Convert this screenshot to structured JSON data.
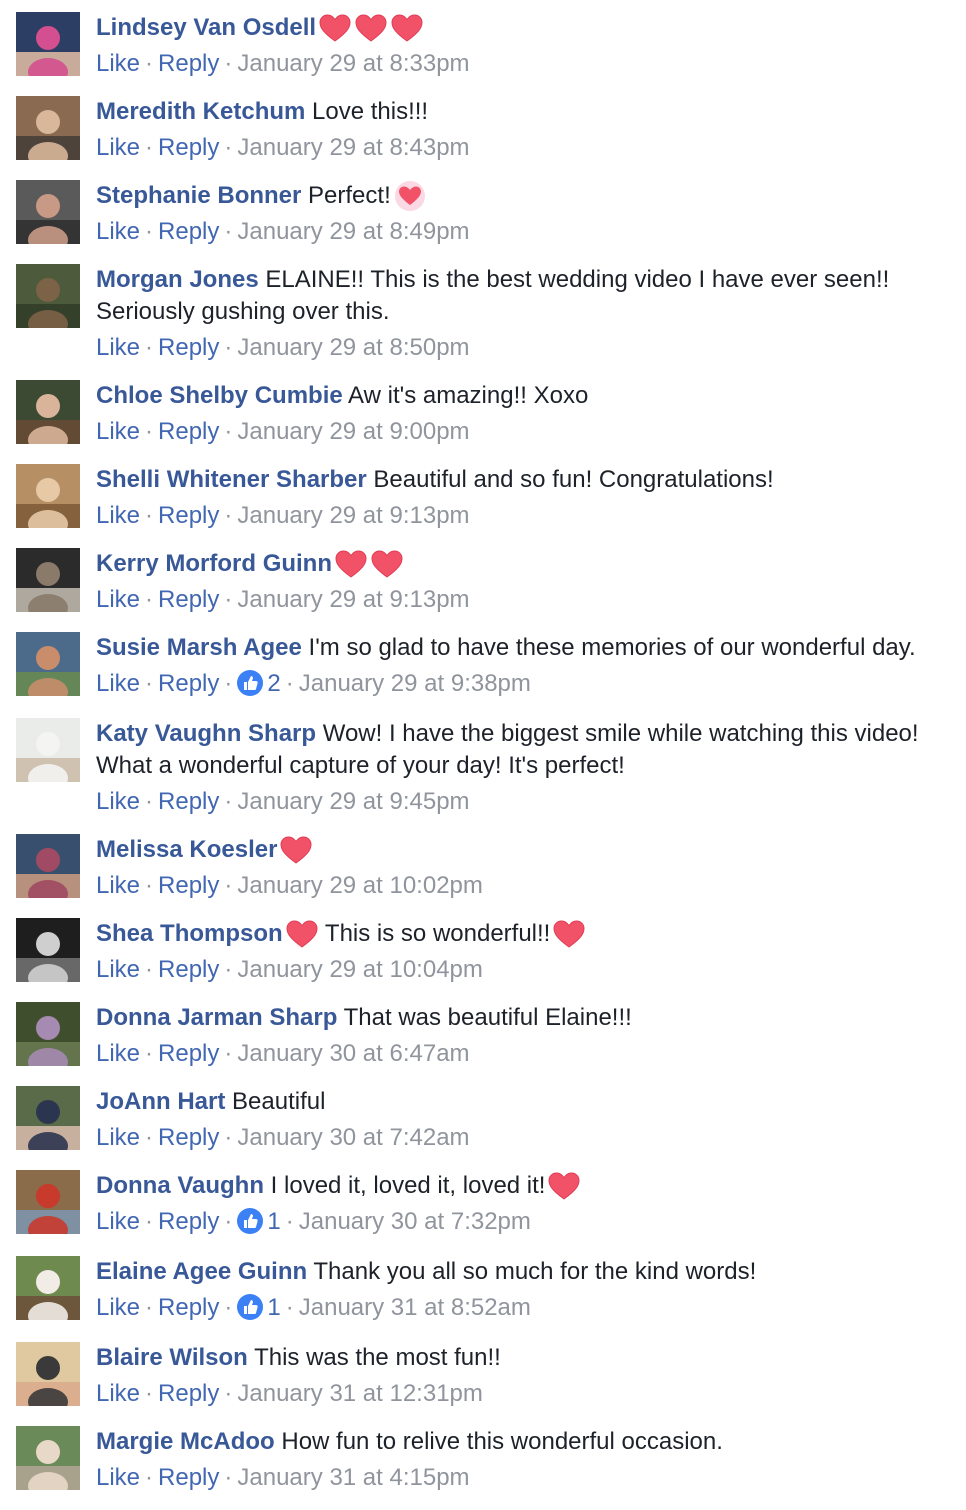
{
  "separator": "·",
  "actions": {
    "like": "Like",
    "reply": "Reply"
  },
  "comments": [
    {
      "name": "Lindsey Van Osdell",
      "text": "",
      "hearts_before": 0,
      "hearts_after": 3,
      "heart_style": "red",
      "likes": "",
      "time": "January 29 at 8:33pm",
      "avatar": [
        "#2c3e63",
        "#d44f8f",
        "#f0c7a8"
      ]
    },
    {
      "name": "Meredith Ketchum",
      "text": "Love this!!!",
      "hearts_before": 0,
      "hearts_after": 0,
      "heart_style": "red",
      "likes": "",
      "time": "January 29 at 8:43pm",
      "avatar": [
        "#8a6b52",
        "#d8b79a",
        "#3f3a36"
      ]
    },
    {
      "name": "Stephanie Bonner",
      "text": "Perfect!",
      "hearts_before": 0,
      "hearts_after": 1,
      "heart_style": "pink",
      "likes": "",
      "time": "January 29 at 8:49pm",
      "avatar": [
        "#5a5a5a",
        "#c89a86",
        "#2a2a2a"
      ]
    },
    {
      "name": "Morgan Jones",
      "text": "ELAINE!! This is the best wedding video I have ever seen!!",
      "text2": "Seriously gushing over this.",
      "hearts_before": 0,
      "hearts_after": 0,
      "heart_style": "red",
      "likes": "",
      "time": "January 29 at 8:50pm",
      "avatar": [
        "#4d5a3c",
        "#7c6247",
        "#2e3a25"
      ]
    },
    {
      "name": "Chloe Shelby Cumbie",
      "text": "Aw it's amazing!! Xoxo",
      "hearts_before": 0,
      "hearts_after": 0,
      "heart_style": "red",
      "likes": "",
      "time": "January 29 at 9:00pm",
      "avatar": [
        "#3d4a33",
        "#d9b49a",
        "#6b4a35"
      ]
    },
    {
      "name": "Shelli Whitener Sharber",
      "text": "Beautiful and so fun! Congratulations!",
      "hearts_before": 0,
      "hearts_after": 0,
      "heart_style": "red",
      "likes": "",
      "time": "January 29 at 9:13pm",
      "avatar": [
        "#b68f64",
        "#e7c9a6",
        "#7a5534"
      ]
    },
    {
      "name": "Kerry Morford Guinn",
      "text": "",
      "hearts_before": 0,
      "hearts_after": 2,
      "heart_style": "red",
      "likes": "",
      "time": "January 29 at 9:13pm",
      "avatar": [
        "#2b2b2b",
        "#8a7a6a",
        "#cfc8bd"
      ]
    },
    {
      "name": "Susie Marsh Agee",
      "text": "I'm so glad to have these memories of our wonderful day.",
      "hearts_before": 0,
      "hearts_after": 0,
      "heart_style": "red",
      "likes": "2",
      "time": "January 29 at 9:38pm",
      "avatar": [
        "#4c6b8a",
        "#c98d6b",
        "#6b8f4a"
      ]
    },
    {
      "name": "Katy Vaughn Sharp",
      "text": "Wow! I have the biggest smile while watching this video!",
      "text2": "What a wonderful capture of your day! It's perfect!",
      "hearts_before": 0,
      "hearts_after": 0,
      "heart_style": "red",
      "likes": "",
      "time": "January 29 at 9:45pm",
      "avatar": [
        "#e9ece8",
        "#f4f4f2",
        "#c8b8a3"
      ]
    },
    {
      "name": "Melissa Koesler",
      "text": "",
      "hearts_before": 0,
      "hearts_after": 1,
      "heart_style": "red",
      "likes": "",
      "time": "January 29 at 10:02pm",
      "avatar": [
        "#38506e",
        "#a04a63",
        "#d8a082"
      ]
    },
    {
      "name": "Shea Thompson",
      "text": "This is so wonderful!!",
      "hearts_before": 1,
      "hearts_after": 1,
      "heart_style": "red",
      "likes": "",
      "time": "January 29 at 10:04pm",
      "avatar": [
        "#1e1e1e",
        "#cfcfcf",
        "#7a7a7a"
      ]
    },
    {
      "name": "Donna Jarman Sharp",
      "text": "That was beautiful Elaine!!!",
      "hearts_before": 0,
      "hearts_after": 0,
      "heart_style": "red",
      "likes": "",
      "time": "January 30 at 6:47am",
      "avatar": [
        "#3f4f2e",
        "#a58bb1",
        "#6e7e56"
      ]
    },
    {
      "name": "JoAnn Hart",
      "text": "Beautiful",
      "hearts_before": 0,
      "hearts_after": 0,
      "heart_style": "red",
      "likes": "",
      "time": "January 30 at 7:42am",
      "avatar": [
        "#5a6b4a",
        "#2c3550",
        "#e3c2b4"
      ]
    },
    {
      "name": "Donna Vaughn",
      "text": "I loved it, loved it, loved it!",
      "hearts_before": 0,
      "hearts_after": 1,
      "heart_style": "red",
      "likes": "1",
      "time": "January 30 at 7:32pm",
      "avatar": [
        "#8a6b4a",
        "#c83a2c",
        "#7a9ab8"
      ]
    },
    {
      "name": "Elaine Agee Guinn",
      "text": "Thank you all so much for the kind words!",
      "hearts_before": 0,
      "hearts_after": 0,
      "heart_style": "red",
      "likes": "1",
      "time": "January 31 at 8:52am",
      "avatar": [
        "#6e8a4e",
        "#f2ece6",
        "#6b4a38"
      ]
    },
    {
      "name": "Blaire Wilson",
      "text": "This was the most fun!!",
      "hearts_before": 0,
      "hearts_after": 0,
      "heart_style": "red",
      "likes": "",
      "time": "January 31 at 12:31pm",
      "avatar": [
        "#e0c8a0",
        "#3a3a3a",
        "#d8a88a"
      ]
    },
    {
      "name": "Margie McAdoo",
      "text": "How fun to relive this wonderful occasion.",
      "hearts_before": 0,
      "hearts_after": 0,
      "heart_style": "red",
      "likes": "",
      "time": "January 31 at 4:15pm",
      "avatar": [
        "#6b8a5a",
        "#e8d8c8",
        "#b8a898"
      ]
    }
  ]
}
